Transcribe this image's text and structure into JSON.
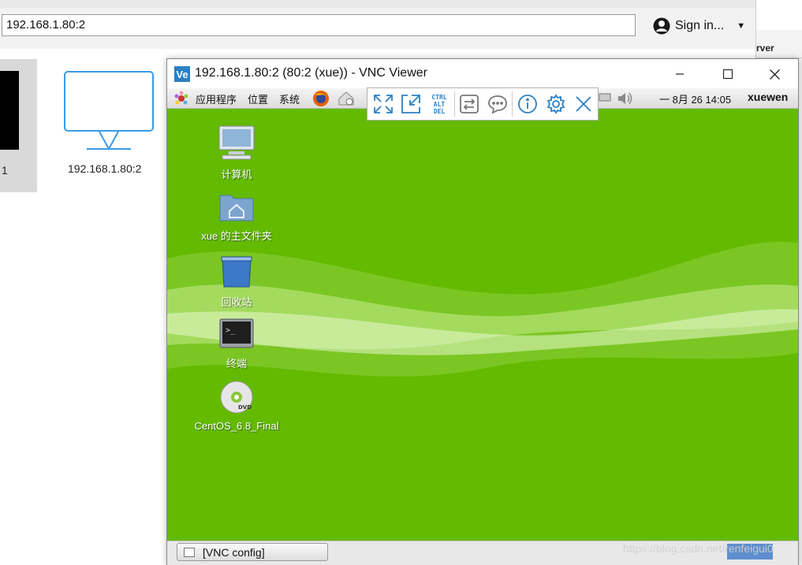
{
  "address_bar": {
    "value": "192.168.1.80:2"
  },
  "account": {
    "signin_label": "Sign in..."
  },
  "address_book": {
    "tiles": [
      {
        "label": "1"
      },
      {
        "label": "192.168.1.80:2"
      }
    ]
  },
  "right_panel": {
    "text": "rver"
  },
  "vnc_window": {
    "app_icon_text": "Ve",
    "title": "192.168.1.80:2 (80:2 (xue)) - VNC Viewer"
  },
  "remote_panel": {
    "menus": [
      "应用程序",
      "位置",
      "系统"
    ],
    "clock": "一 8月 26 14:05",
    "user": "xuewen"
  },
  "vnc_toolbar": {
    "buttons": [
      {
        "icon": "fullscreen-icon"
      },
      {
        "icon": "scale-icon"
      },
      {
        "icon": "ctrl-alt-del-icon",
        "text": "CTRL ALT DEL"
      },
      {
        "icon": "transfer-files-icon"
      },
      {
        "icon": "chat-icon"
      },
      {
        "icon": "info-icon"
      },
      {
        "icon": "settings-icon"
      },
      {
        "icon": "close-toolbar-icon"
      }
    ],
    "accent": "#2b80c5"
  },
  "desktop": {
    "background_color": "#63ba00",
    "icons": [
      {
        "label": "计算机",
        "icon": "computer-icon"
      },
      {
        "label": "xue 的主文件夹",
        "icon": "home-folder-icon"
      },
      {
        "label": "回收站",
        "icon": "trash-icon"
      },
      {
        "label": "终端",
        "icon": "terminal-icon"
      },
      {
        "label": "CentOS_6.8_Final",
        "icon": "dvd-icon"
      }
    ]
  },
  "statusbar": {
    "task_label": "[VNC config]"
  },
  "watermark": "https://blog.csdn.net/renfeigui0"
}
